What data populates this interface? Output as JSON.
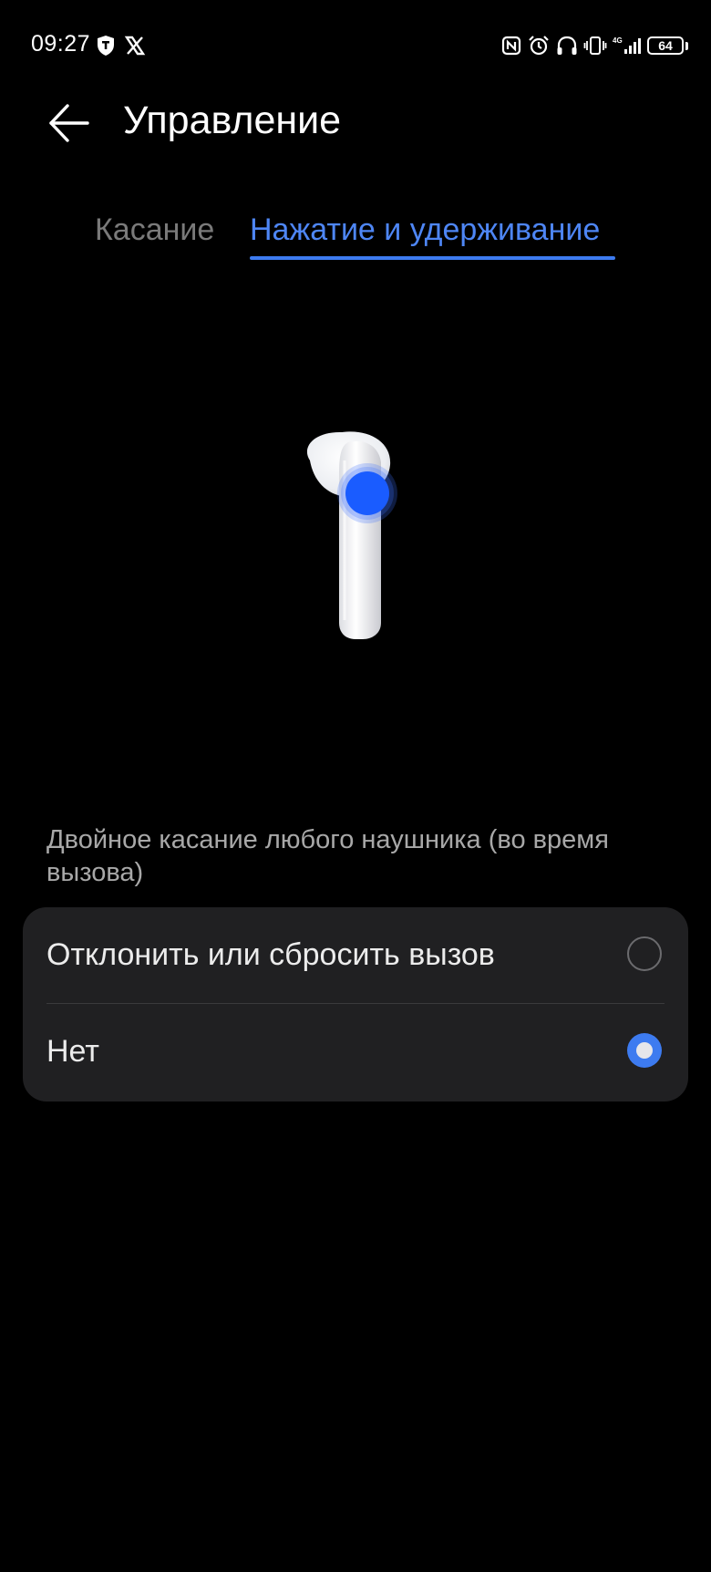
{
  "status_bar": {
    "time": "09:27",
    "battery_level": "64",
    "network_label": "4G"
  },
  "header": {
    "title": "Управление"
  },
  "tabs": [
    {
      "label": "Касание",
      "active": false
    },
    {
      "label": "Нажатие и удерживание",
      "active": true
    }
  ],
  "section": {
    "caption": "Двойное касание любого наушника (во время вызова)"
  },
  "options": [
    {
      "label": "Отклонить или сбросить вызов",
      "selected": false
    },
    {
      "label": "Нет",
      "selected": true
    }
  ],
  "colors": {
    "accent": "#3d7bf0",
    "background": "#000000",
    "card": "#202022",
    "inactive_tab": "#7a7a7a",
    "caption": "#a8a8a8"
  }
}
